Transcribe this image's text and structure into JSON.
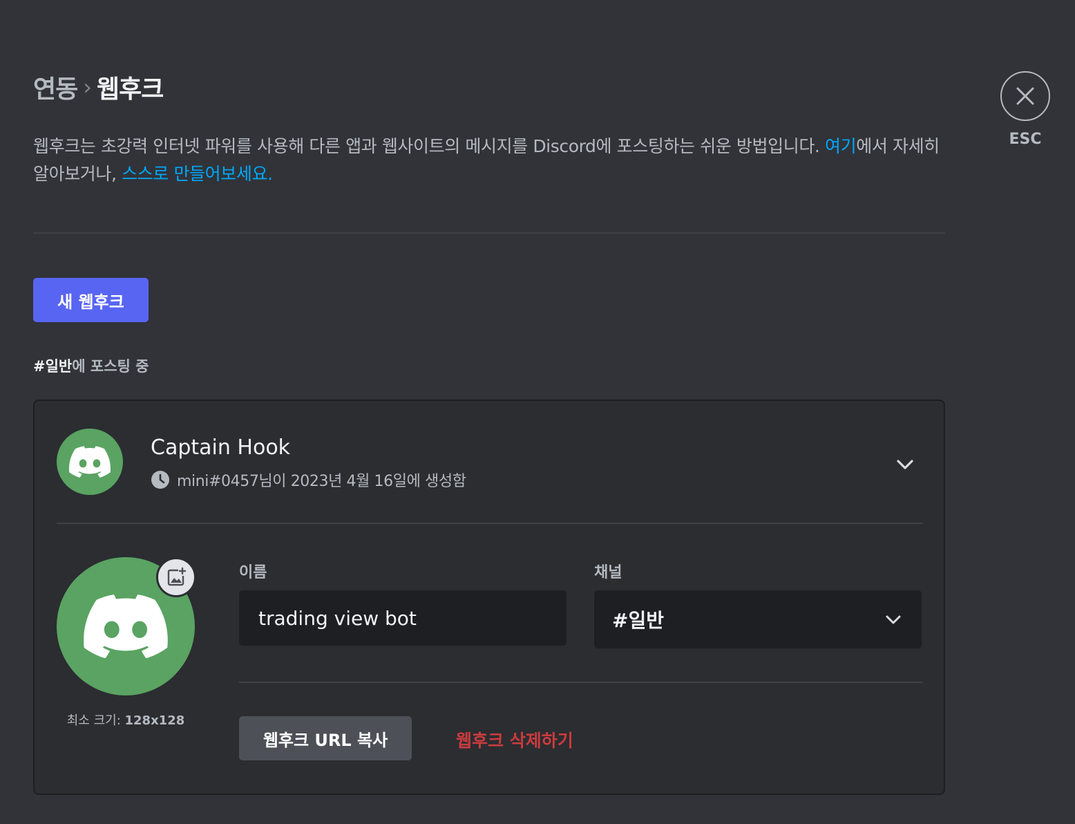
{
  "breadcrumb": {
    "parent": "연동",
    "separator": "›",
    "current": "웹후크"
  },
  "description": {
    "text_1": "웹후크는 초강력 인터넷 파워를 사용해 다른 앱과 웹사이트의 메시지를 Discord에 포스팅하는 쉬운 방법입니다. ",
    "link_1": "여기",
    "text_2": "에서 자세히 알아보거나, ",
    "link_2": "스스로 만들어보세요."
  },
  "close": {
    "icon": "close-icon",
    "label": "ESC"
  },
  "new_webhook_button": "새 웹후크",
  "posting": {
    "channel": "#일반",
    "suffix": "에 포스팅 중"
  },
  "webhook": {
    "name": "Captain Hook",
    "created_meta": "mini#0457님이 2023년 4월 16일에 생성함",
    "avatar_color": "#5aa362",
    "min_size_label": "최소 크기:",
    "min_size_value": "128x128",
    "name_field_label": "이름",
    "name_field_value": "trading view bot",
    "channel_field_label": "채널",
    "channel_field_value": "#일반",
    "copy_url_button": "웹후크 URL 복사",
    "delete_link": "웹후크 삭제하기"
  },
  "colors": {
    "background": "#313338",
    "card": "#2b2d31",
    "brand": "#5865f2",
    "link": "#00a8fc",
    "danger": "#f23f42"
  }
}
